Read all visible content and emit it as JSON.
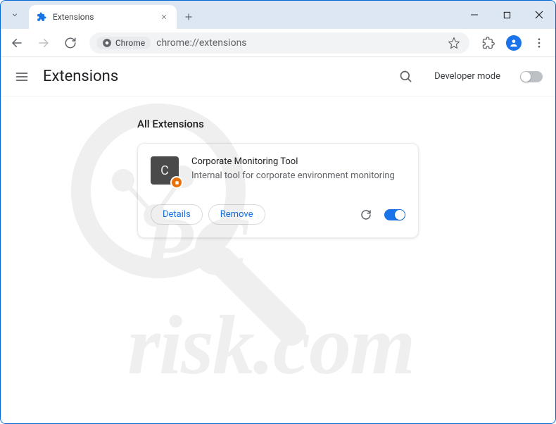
{
  "tab": {
    "title": "Extensions"
  },
  "omnibox": {
    "chip": "Chrome",
    "url": "chrome://extensions"
  },
  "page": {
    "title": "Extensions",
    "dev_mode_label": "Developer mode",
    "section_title": "All Extensions"
  },
  "extension": {
    "icon_letter": "C",
    "name": "Corporate Monitoring Tool",
    "description": "Internal tool for corporate environment monitoring",
    "details_label": "Details",
    "remove_label": "Remove",
    "enabled": true
  },
  "watermark": {
    "line1": "PC",
    "line2": "risk.com"
  }
}
